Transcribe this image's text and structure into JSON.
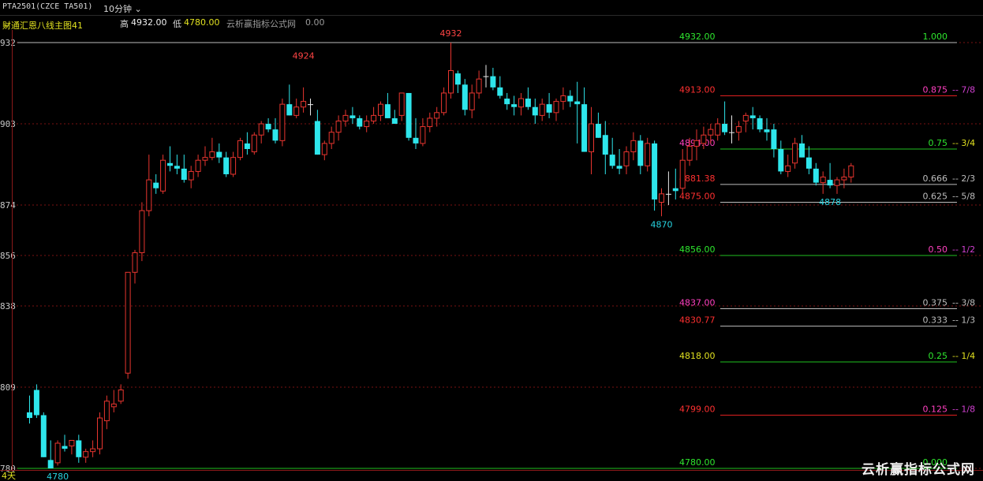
{
  "header": {
    "symbol": "PTA2501(CZCE TA501)",
    "period": "10分钟",
    "indicator_name": "财通汇恩八线主图41",
    "high_label": "高",
    "high_value": "4932.00",
    "low_label": "低",
    "low_value": "4780.00",
    "source_label": "云析赢指标公式网",
    "source_value": "0.00"
  },
  "watermark": "云析赢指标公式网",
  "colors": {
    "up": "#e8352f",
    "down": "#2ee6ec",
    "grid": "#7a1212",
    "bg": "#000000"
  },
  "chart_data": {
    "type": "candlestick",
    "y_axis_ticks": [
      "932",
      "903",
      "874",
      "856",
      "838",
      "809",
      "780"
    ],
    "x_label": "4天",
    "ylim": [
      4780,
      4932
    ],
    "peak_labels": [
      {
        "text": "4924",
        "bar": 39,
        "value": 4924,
        "color": "#ff4444"
      },
      {
        "text": "4932",
        "bar": 60,
        "value": 4932,
        "color": "#ff4444"
      },
      {
        "text": "4870",
        "bar": 90,
        "value": 4870,
        "color": "#27d3e0"
      },
      {
        "text": "4878",
        "bar": 114,
        "value": 4878,
        "color": "#27d3e0"
      },
      {
        "text": "4780",
        "bar": 4,
        "value": 4780,
        "color": "#27d3e0"
      }
    ],
    "levels": [
      {
        "value": 4932.0,
        "left": "4932.00",
        "left_color": "#2ee62e",
        "frac": "1.000",
        "frac_color": "#2ee62e",
        "eighth": "",
        "line_color": "#bdbdbd",
        "line_start": "full"
      },
      {
        "value": 4913.0,
        "left": "4913.00",
        "left_color": "#ff3030",
        "frac": "0.875",
        "frac_color": "#ff40c0",
        "eighth": "7/8",
        "eighth_color": "#d040d0",
        "line_color": "#e02020",
        "line_start": "right"
      },
      {
        "value": 4894.0,
        "left": "4894.00",
        "left_color": "#ff40c0",
        "frac": "0.75",
        "frac_color": "#2ee62e",
        "eighth": "3/4",
        "eighth_color": "#e0e020",
        "line_color": "#1fbf1f",
        "line_start": "right"
      },
      {
        "value": 4881.38,
        "left": "4881.38",
        "left_color": "#ff3030",
        "frac": "0.666",
        "frac_color": "#bdbdbd",
        "eighth": "2/3",
        "eighth_color": "#bdbdbd",
        "line_color": "#bdbdbd",
        "line_start": "right"
      },
      {
        "value": 4875.0,
        "left": "4875.00",
        "left_color": "#ff3030",
        "frac": "0.625",
        "frac_color": "#bdbdbd",
        "eighth": "5/8",
        "eighth_color": "#bdbdbd",
        "line_color": "#bdbdbd",
        "line_start": "right"
      },
      {
        "value": 4856.0,
        "left": "4856.00",
        "left_color": "#2ee62e",
        "frac": "0.50",
        "frac_color": "#ff40c0",
        "eighth": "1/2",
        "eighth_color": "#d040d0",
        "line_color": "#1fbf1f",
        "line_start": "right"
      },
      {
        "value": 4837.0,
        "left": "4837.00",
        "left_color": "#ff40c0",
        "frac": "0.375",
        "frac_color": "#bdbdbd",
        "eighth": "3/8",
        "eighth_color": "#bdbdbd",
        "line_color": "#bdbdbd",
        "line_start": "right"
      },
      {
        "value": 4830.77,
        "left": "4830.77",
        "left_color": "#ff3030",
        "frac": "0.333",
        "frac_color": "#bdbdbd",
        "eighth": "1/3",
        "eighth_color": "#bdbdbd",
        "line_color": "#bdbdbd",
        "line_start": "right"
      },
      {
        "value": 4818.0,
        "left": "4818.00",
        "left_color": "#e0e020",
        "frac": "0.25",
        "frac_color": "#2ee62e",
        "eighth": "1/4",
        "eighth_color": "#e0e020",
        "line_color": "#1fbf1f",
        "line_start": "right"
      },
      {
        "value": 4799.0,
        "left": "4799.00",
        "left_color": "#ff3030",
        "frac": "0.125",
        "frac_color": "#ff40c0",
        "eighth": "1/8",
        "eighth_color": "#d040d0",
        "line_color": "#e02020",
        "line_start": "right"
      },
      {
        "value": 4780.0,
        "left": "4780.00",
        "left_color": "#2ee62e",
        "frac": "0.000",
        "frac_color": "#2ee62e",
        "eighth": "",
        "line_color": "#1fbf1f",
        "line_start": "full"
      }
    ],
    "candles": [
      [
        4800,
        4806,
        4796,
        4798
      ],
      [
        4808,
        4810,
        4798,
        4799
      ],
      [
        4799,
        4800,
        4784,
        4784
      ],
      [
        4783,
        4790,
        4780,
        4780
      ],
      [
        4782,
        4790,
        4781,
        4789
      ],
      [
        4788,
        4792,
        4786,
        4787
      ],
      [
        4788,
        4790,
        4785,
        4790
      ],
      [
        4790,
        4792,
        4782,
        4784
      ],
      [
        4784,
        4787,
        4782,
        4786
      ],
      [
        4786,
        4790,
        4784,
        4787
      ],
      [
        4787,
        4800,
        4785,
        4798
      ],
      [
        4797,
        4806,
        4794,
        4804
      ],
      [
        4802,
        4808,
        4800,
        4803
      ],
      [
        4804,
        4810,
        4803,
        4808
      ],
      [
        4814,
        4850,
        4812,
        4850
      ],
      [
        4850,
        4858,
        4846,
        4857
      ],
      [
        4857,
        4875,
        4854,
        4872
      ],
      [
        4872,
        4892,
        4870,
        4883
      ],
      [
        4882,
        4885,
        4878,
        4880
      ],
      [
        4879,
        4892,
        4878,
        4890
      ],
      [
        4889,
        4895,
        4886,
        4888
      ],
      [
        4888,
        4892,
        4885,
        4887
      ],
      [
        4887,
        4892,
        4882,
        4883
      ],
      [
        4883,
        4888,
        4880,
        4886
      ],
      [
        4886,
        4892,
        4884,
        4890
      ],
      [
        4890,
        4895,
        4888,
        4891
      ],
      [
        4891,
        4898,
        4890,
        4893
      ],
      [
        4893,
        4896,
        4889,
        4891
      ],
      [
        4891,
        4893,
        4884,
        4885
      ],
      [
        4885,
        4893,
        4884,
        4891
      ],
      [
        4891,
        4898,
        4890,
        4897
      ],
      [
        4896,
        4900,
        4892,
        4894
      ],
      [
        4893,
        4900,
        4892,
        4899
      ],
      [
        4899,
        4904,
        4896,
        4903
      ],
      [
        4903,
        4905,
        4900,
        4901
      ],
      [
        4901,
        4905,
        4896,
        4897
      ],
      [
        4897,
        4912,
        4895,
        4910
      ],
      [
        4910,
        4917,
        4906,
        4906
      ],
      [
        4906,
        4912,
        4905,
        4909
      ],
      [
        4909,
        4916,
        4907,
        4911
      ],
      [
        4910,
        4912,
        4906,
        4910
      ],
      [
        4904,
        4908,
        4892,
        4892
      ],
      [
        4892,
        4897,
        4890,
        4896
      ],
      [
        4896,
        4902,
        4894,
        4900
      ],
      [
        4900,
        4906,
        4897,
        4904
      ],
      [
        4904,
        4908,
        4902,
        4906
      ],
      [
        4906,
        4909,
        4903,
        4905
      ],
      [
        4905,
        4906,
        4901,
        4902
      ],
      [
        4902,
        4906,
        4900,
        4904
      ],
      [
        4904,
        4909,
        4903,
        4906
      ],
      [
        4906,
        4911,
        4904,
        4910
      ],
      [
        4910,
        4914,
        4905,
        4905
      ],
      [
        4905,
        4908,
        4903,
        4903
      ],
      [
        4906,
        4914,
        4904,
        4914
      ],
      [
        4914,
        4914,
        4897,
        4898
      ],
      [
        4898,
        4905,
        4894,
        4896
      ],
      [
        4896,
        4905,
        4895,
        4902
      ],
      [
        4902,
        4907,
        4900,
        4905
      ],
      [
        4905,
        4909,
        4902,
        4907
      ],
      [
        4907,
        4916,
        4906,
        4914
      ],
      [
        4914,
        4932,
        4912,
        4922
      ],
      [
        4921,
        4922,
        4914,
        4917
      ],
      [
        4917,
        4919,
        4906,
        4908
      ],
      [
        4908,
        4917,
        4905,
        4914
      ],
      [
        4914,
        4922,
        4912,
        4919
      ],
      [
        4920,
        4924,
        4916,
        4920
      ],
      [
        4920,
        4923,
        4915,
        4916
      ],
      [
        4916,
        4920,
        4912,
        4913
      ],
      [
        4912,
        4914,
        4908,
        4910
      ],
      [
        4910,
        4913,
        4906,
        4909
      ],
      [
        4909,
        4914,
        4906,
        4912
      ],
      [
        4912,
        4916,
        4908,
        4909
      ],
      [
        4909,
        4912,
        4903,
        4906
      ],
      [
        4906,
        4912,
        4904,
        4910
      ],
      [
        4910,
        4914,
        4905,
        4907
      ],
      [
        4907,
        4912,
        4904,
        4911
      ],
      [
        4911,
        4916,
        4908,
        4913
      ],
      [
        4913,
        4915,
        4909,
        4911
      ],
      [
        4911,
        4918,
        4896,
        4910
      ],
      [
        4910,
        4916,
        4893,
        4893
      ],
      [
        4893,
        4909,
        4885,
        4903
      ],
      [
        4903,
        4907,
        4898,
        4898
      ],
      [
        4899,
        4904,
        4885,
        4892
      ],
      [
        4892,
        4898,
        4887,
        4888
      ],
      [
        4888,
        4894,
        4885,
        4887
      ],
      [
        4888,
        4895,
        4885,
        4893
      ],
      [
        4893,
        4900,
        4890,
        4897
      ],
      [
        4897,
        4899,
        4885,
        4888
      ],
      [
        4888,
        4898,
        4886,
        4896
      ],
      [
        4896,
        4897,
        4872,
        4876
      ],
      [
        4875,
        4880,
        4870,
        4878
      ],
      [
        4878,
        4886,
        4874,
        4878
      ],
      [
        4880,
        4887,
        4876,
        4879
      ],
      [
        4880,
        4894,
        4878,
        4890
      ],
      [
        4890,
        4898,
        4888,
        4895
      ],
      [
        4895,
        4901,
        4890,
        4897
      ],
      [
        4896,
        4902,
        4894,
        4899
      ],
      [
        4899,
        4903,
        4896,
        4901
      ],
      [
        4899,
        4905,
        4897,
        4903
      ],
      [
        4903,
        4911,
        4899,
        4900
      ],
      [
        4900,
        4906,
        4896,
        4900
      ],
      [
        4900,
        4904,
        4897,
        4902
      ],
      [
        4904,
        4907,
        4900,
        4906
      ],
      [
        4906,
        4909,
        4901,
        4905
      ],
      [
        4905,
        4906,
        4900,
        4901
      ],
      [
        4901,
        4905,
        4897,
        4900
      ],
      [
        4901,
        4903,
        4891,
        4894
      ],
      [
        4894,
        4897,
        4885,
        4886
      ],
      [
        4886,
        4892,
        4884,
        4888
      ],
      [
        4889,
        4898,
        4887,
        4896
      ],
      [
        4896,
        4899,
        4891,
        4891
      ],
      [
        4891,
        4895,
        4885,
        4887
      ],
      [
        4887,
        4889,
        4881,
        4882
      ],
      [
        4882,
        4886,
        4878,
        4884
      ],
      [
        4883,
        4889,
        4880,
        4881
      ],
      [
        4881,
        4884,
        4878,
        4883
      ],
      [
        4883,
        4887,
        4880,
        4884
      ],
      [
        4884,
        4889,
        4882,
        4888
      ]
    ]
  }
}
